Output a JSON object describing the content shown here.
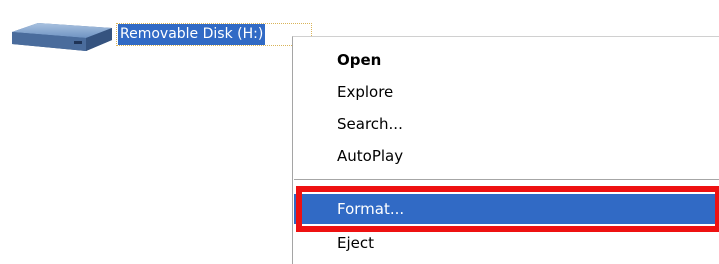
{
  "desktop": {
    "drive_label": "Removable Disk (H:)",
    "drive_icon": "removable-disk-icon"
  },
  "context_menu": {
    "items": [
      {
        "label": "Open",
        "bold": true
      },
      {
        "label": "Explore"
      },
      {
        "label": "Search..."
      },
      {
        "label": "AutoPlay"
      },
      {
        "label": "Format...",
        "selected": true
      },
      {
        "label": "Eject"
      }
    ]
  },
  "colors": {
    "selection": "#316ac5",
    "highlight_annotation": "#ee1111"
  }
}
